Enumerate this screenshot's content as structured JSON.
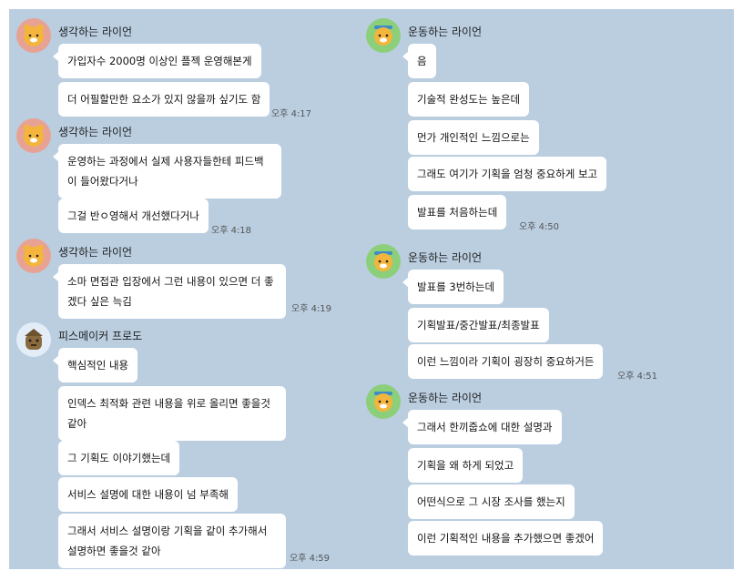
{
  "colors": {
    "chat_bg": "#bacee0",
    "bubble": "#ffffff"
  },
  "left_column": [
    {
      "sender": "생각하는 라이언",
      "avatar": "ryan-thinking-icon",
      "messages": [
        "가입자수 2000명 이상인 플젝 운영해본게",
        "더 어필할만한 요소가 있지 않을까 싶기도 함"
      ],
      "time": "오후 4:17"
    },
    {
      "sender": "생각하는 라이언",
      "avatar": "ryan-thinking-icon",
      "messages": [
        "운영하는 과정에서 실제 사용자들한테 피드백이 들어왔다거나",
        "그걸 반ㅇ영해서 개선했다거나"
      ],
      "time": "오후 4:18"
    },
    {
      "sender": "생각하는 라이언",
      "avatar": "ryan-thinking-icon",
      "messages": [
        "소마 면접관 입장에서 그런 내용이 있으면 더 좋겠다 싶은 늑김"
      ],
      "time": "오후 4:19"
    },
    {
      "sender": "피스메이커 프로도",
      "avatar": "frodo-peacemaker-icon",
      "messages": [
        "핵심적인 내용",
        "인덱스 최적화 관련 내용을 위로 올리면 좋을것 같아",
        "그 기획도 이야기했는데",
        "서비스 설명에 대한 내용이 넘 부족해",
        "그래서 서비스 설명이랑 기획을 같이 추가해서 설명하면 좋을것 같아"
      ],
      "time": "오후 4:59"
    }
  ],
  "right_column": [
    {
      "sender": "운동하는 라이언",
      "avatar": "ryan-exercising-icon",
      "messages": [
        "음",
        "기술적 완성도는 높은데",
        "먼가 개인적인 느낌으로는",
        "그래도 여기가 기획을 엄청 중요하게 보고",
        "발표를 처음하는데"
      ],
      "time": "오후 4:50"
    },
    {
      "sender": "운동하는 라이언",
      "avatar": "ryan-exercising-icon",
      "messages": [
        "발표를 3번하는데",
        "기획발표/중간발표/최종발표",
        "이런 느낌이라 기획이 굉장히 중요하거든"
      ],
      "time": "오후 4:51"
    },
    {
      "sender": "운동하는 라이언",
      "avatar": "ryan-exercising-icon",
      "messages": [
        "그래서 한끼줍쇼에 대한 설명과",
        "기획을 왜 하게 되었고",
        "어떤식으로 그 시장 조사를 했는지",
        "이런 기획적인 내용을 추가했으면 좋겠어"
      ],
      "time": null
    }
  ]
}
